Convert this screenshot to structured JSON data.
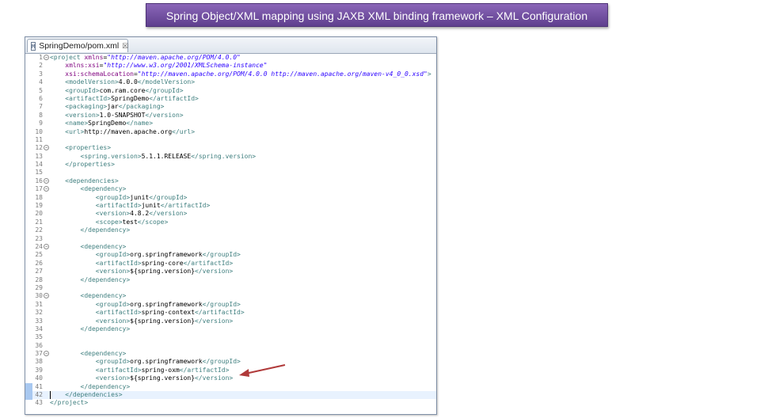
{
  "title": "Spring Object/XML mapping using JAXB XML binding framework – XML Configuration",
  "editor": {
    "tab_label": "SpringDemo/pom.xml",
    "tab_icon": "M",
    "close_glyph": "☒",
    "fold_glyph": "⊖",
    "current_line": 42,
    "lines": [
      {
        "n": "1",
        "fold": true,
        "tokens": [
          [
            "t",
            "<project "
          ],
          [
            "a",
            "xmlns"
          ],
          [
            "x",
            "="
          ],
          [
            "v",
            "\"http://maven.apache.org/POM/4.0.0\""
          ]
        ]
      },
      {
        "n": "2",
        "tokens": [
          [
            "x",
            "    "
          ],
          [
            "a",
            "xmlns:xsi"
          ],
          [
            "x",
            "="
          ],
          [
            "v",
            "\"http://www.w3.org/2001/XMLSchema-instance\""
          ]
        ]
      },
      {
        "n": "3",
        "tokens": [
          [
            "x",
            "    "
          ],
          [
            "a",
            "xsi:schemaLocation"
          ],
          [
            "x",
            "="
          ],
          [
            "v",
            "\"http://maven.apache.org/POM/4.0.0 http://maven.apache.org/maven-v4_0_0.xsd\""
          ],
          [
            "t",
            ">"
          ]
        ]
      },
      {
        "n": "4",
        "tokens": [
          [
            "x",
            "    "
          ],
          [
            "t",
            "<modelVersion>"
          ],
          [
            "x",
            "4.0.0"
          ],
          [
            "t",
            "</modelVersion>"
          ]
        ]
      },
      {
        "n": "5",
        "tokens": [
          [
            "x",
            "    "
          ],
          [
            "t",
            "<groupId>"
          ],
          [
            "x",
            "com.ram.core"
          ],
          [
            "t",
            "</groupId>"
          ]
        ]
      },
      {
        "n": "6",
        "tokens": [
          [
            "x",
            "    "
          ],
          [
            "t",
            "<artifactId>"
          ],
          [
            "x",
            "SpringDemo"
          ],
          [
            "t",
            "</artifactId>"
          ]
        ]
      },
      {
        "n": "7",
        "tokens": [
          [
            "x",
            "    "
          ],
          [
            "t",
            "<packaging>"
          ],
          [
            "x",
            "jar"
          ],
          [
            "t",
            "</packaging>"
          ]
        ]
      },
      {
        "n": "8",
        "tokens": [
          [
            "x",
            "    "
          ],
          [
            "t",
            "<version>"
          ],
          [
            "x",
            "1.0-SNAPSHOT"
          ],
          [
            "t",
            "</version>"
          ]
        ]
      },
      {
        "n": "9",
        "tokens": [
          [
            "x",
            "    "
          ],
          [
            "t",
            "<name>"
          ],
          [
            "x",
            "SpringDemo"
          ],
          [
            "t",
            "</name>"
          ]
        ]
      },
      {
        "n": "10",
        "tokens": [
          [
            "x",
            "    "
          ],
          [
            "t",
            "<url>"
          ],
          [
            "x",
            "http://maven.apache.org"
          ],
          [
            "t",
            "</url>"
          ]
        ]
      },
      {
        "n": "11",
        "tokens": []
      },
      {
        "n": "12",
        "fold": true,
        "tokens": [
          [
            "x",
            "    "
          ],
          [
            "t",
            "<properties>"
          ]
        ]
      },
      {
        "n": "13",
        "tokens": [
          [
            "x",
            "        "
          ],
          [
            "t",
            "<spring.version>"
          ],
          [
            "x",
            "5.1.1.RELEASE"
          ],
          [
            "t",
            "</spring.version>"
          ]
        ]
      },
      {
        "n": "14",
        "tokens": [
          [
            "x",
            "    "
          ],
          [
            "t",
            "</properties>"
          ]
        ]
      },
      {
        "n": "15",
        "tokens": []
      },
      {
        "n": "16",
        "fold": true,
        "tokens": [
          [
            "x",
            "    "
          ],
          [
            "t",
            "<dependencies>"
          ]
        ]
      },
      {
        "n": "17",
        "fold": true,
        "tokens": [
          [
            "x",
            "        "
          ],
          [
            "t",
            "<dependency>"
          ]
        ]
      },
      {
        "n": "18",
        "tokens": [
          [
            "x",
            "            "
          ],
          [
            "t",
            "<groupId>"
          ],
          [
            "x",
            "junit"
          ],
          [
            "t",
            "</groupId>"
          ]
        ]
      },
      {
        "n": "19",
        "tokens": [
          [
            "x",
            "            "
          ],
          [
            "t",
            "<artifactId>"
          ],
          [
            "x",
            "junit"
          ],
          [
            "t",
            "</artifactId>"
          ]
        ]
      },
      {
        "n": "20",
        "tokens": [
          [
            "x",
            "            "
          ],
          [
            "t",
            "<version>"
          ],
          [
            "x",
            "4.8.2"
          ],
          [
            "t",
            "</version>"
          ]
        ]
      },
      {
        "n": "21",
        "tokens": [
          [
            "x",
            "            "
          ],
          [
            "t",
            "<scope>"
          ],
          [
            "x",
            "test"
          ],
          [
            "t",
            "</scope>"
          ]
        ]
      },
      {
        "n": "22",
        "tokens": [
          [
            "x",
            "        "
          ],
          [
            "t",
            "</dependency>"
          ]
        ]
      },
      {
        "n": "23",
        "tokens": []
      },
      {
        "n": "24",
        "fold": true,
        "tokens": [
          [
            "x",
            "        "
          ],
          [
            "t",
            "<dependency>"
          ]
        ]
      },
      {
        "n": "25",
        "tokens": [
          [
            "x",
            "            "
          ],
          [
            "t",
            "<groupId>"
          ],
          [
            "x",
            "org.springframework"
          ],
          [
            "t",
            "</groupId>"
          ]
        ]
      },
      {
        "n": "26",
        "tokens": [
          [
            "x",
            "            "
          ],
          [
            "t",
            "<artifactId>"
          ],
          [
            "x",
            "spring-core"
          ],
          [
            "t",
            "</artifactId>"
          ]
        ]
      },
      {
        "n": "27",
        "tokens": [
          [
            "x",
            "            "
          ],
          [
            "t",
            "<version>"
          ],
          [
            "x",
            "${spring.version}"
          ],
          [
            "t",
            "</version>"
          ]
        ]
      },
      {
        "n": "28",
        "tokens": [
          [
            "x",
            "        "
          ],
          [
            "t",
            "</dependency>"
          ]
        ]
      },
      {
        "n": "29",
        "tokens": []
      },
      {
        "n": "30",
        "fold": true,
        "tokens": [
          [
            "x",
            "        "
          ],
          [
            "t",
            "<dependency>"
          ]
        ]
      },
      {
        "n": "31",
        "tokens": [
          [
            "x",
            "            "
          ],
          [
            "t",
            "<groupId>"
          ],
          [
            "x",
            "org.springframework"
          ],
          [
            "t",
            "</groupId>"
          ]
        ]
      },
      {
        "n": "32",
        "tokens": [
          [
            "x",
            "            "
          ],
          [
            "t",
            "<artifactId>"
          ],
          [
            "x",
            "spring-context"
          ],
          [
            "t",
            "</artifactId>"
          ]
        ]
      },
      {
        "n": "33",
        "tokens": [
          [
            "x",
            "            "
          ],
          [
            "t",
            "<version>"
          ],
          [
            "x",
            "${spring.version}"
          ],
          [
            "t",
            "</version>"
          ]
        ]
      },
      {
        "n": "34",
        "tokens": [
          [
            "x",
            "        "
          ],
          [
            "t",
            "</dependency>"
          ]
        ]
      },
      {
        "n": "35",
        "tokens": []
      },
      {
        "n": "36",
        "tokens": []
      },
      {
        "n": "37",
        "fold": true,
        "tokens": [
          [
            "x",
            "        "
          ],
          [
            "t",
            "<dependency>"
          ]
        ]
      },
      {
        "n": "38",
        "tokens": [
          [
            "x",
            "            "
          ],
          [
            "t",
            "<groupId>"
          ],
          [
            "x",
            "org.springframework"
          ],
          [
            "t",
            "</groupId>"
          ]
        ]
      },
      {
        "n": "39",
        "tokens": [
          [
            "x",
            "            "
          ],
          [
            "t",
            "<artifactId>"
          ],
          [
            "x",
            "spring-oxm"
          ],
          [
            "t",
            "</artifactId>"
          ]
        ]
      },
      {
        "n": "40",
        "tokens": [
          [
            "x",
            "            "
          ],
          [
            "t",
            "<version>"
          ],
          [
            "x",
            "${spring.version}"
          ],
          [
            "t",
            "</version>"
          ]
        ]
      },
      {
        "n": "41",
        "tokens": [
          [
            "x",
            "        "
          ],
          [
            "t",
            "</dependency>"
          ]
        ]
      },
      {
        "n": "42",
        "tokens": [
          [
            "x",
            "    "
          ],
          [
            "t",
            "</dependencies>"
          ]
        ]
      },
      {
        "n": "43",
        "tokens": [
          [
            "t",
            "</project>"
          ]
        ]
      }
    ]
  },
  "colors": {
    "banner": "#6f4fa0",
    "tag": "#3f7f7f",
    "attribute": "#7f007f",
    "attribute_value": "#2a00ff",
    "arrow": "#b03a3a",
    "current_line_bg": "#e8f2fe"
  },
  "annotation_arrow_icon": "arrow-left-icon"
}
